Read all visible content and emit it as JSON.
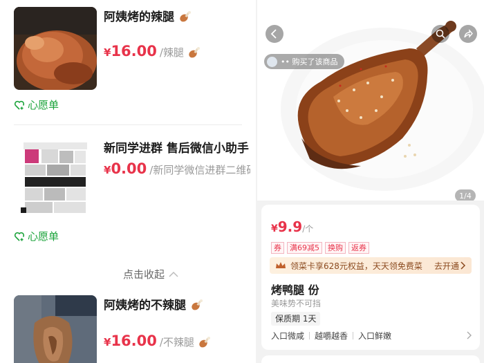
{
  "left": {
    "products": [
      {
        "title": "阿姨烤的辣腿",
        "currency": "¥",
        "price": "16.00",
        "unit": "/辣腿"
      },
      {
        "title": "新同学进群 售后微信小助手",
        "currency": "¥",
        "price": "0.00",
        "unit": "/新同学微信进群二维码"
      },
      {
        "title": "阿姨烤的不辣腿",
        "currency": "¥",
        "price": "16.00",
        "unit": "/不辣腿"
      }
    ],
    "wishlist_label": "心愿单",
    "collapse_label": "点击收起"
  },
  "right": {
    "buyer_pill": "•• 购买了该商品",
    "image_counter": "1/4",
    "price": {
      "currency": "¥",
      "amount": "9.9",
      "unit": "/个"
    },
    "tags": [
      "券",
      "满69减5",
      "换购",
      "返券"
    ],
    "banner": {
      "text": "领菜卡享628元权益，天天领免费菜",
      "cta": "去开通"
    },
    "title": "烤鸭腿 份",
    "subtitle": "美味势不可挡",
    "shelf_life": "保质期 1天",
    "features": [
      "入口微咸",
      "越嚼越香",
      "入口鲜嫩"
    ]
  },
  "colors": {
    "accent_red": "#e8334a",
    "wishlist_green": "#1aa33a",
    "banner_brown": "#8b4a1f"
  }
}
